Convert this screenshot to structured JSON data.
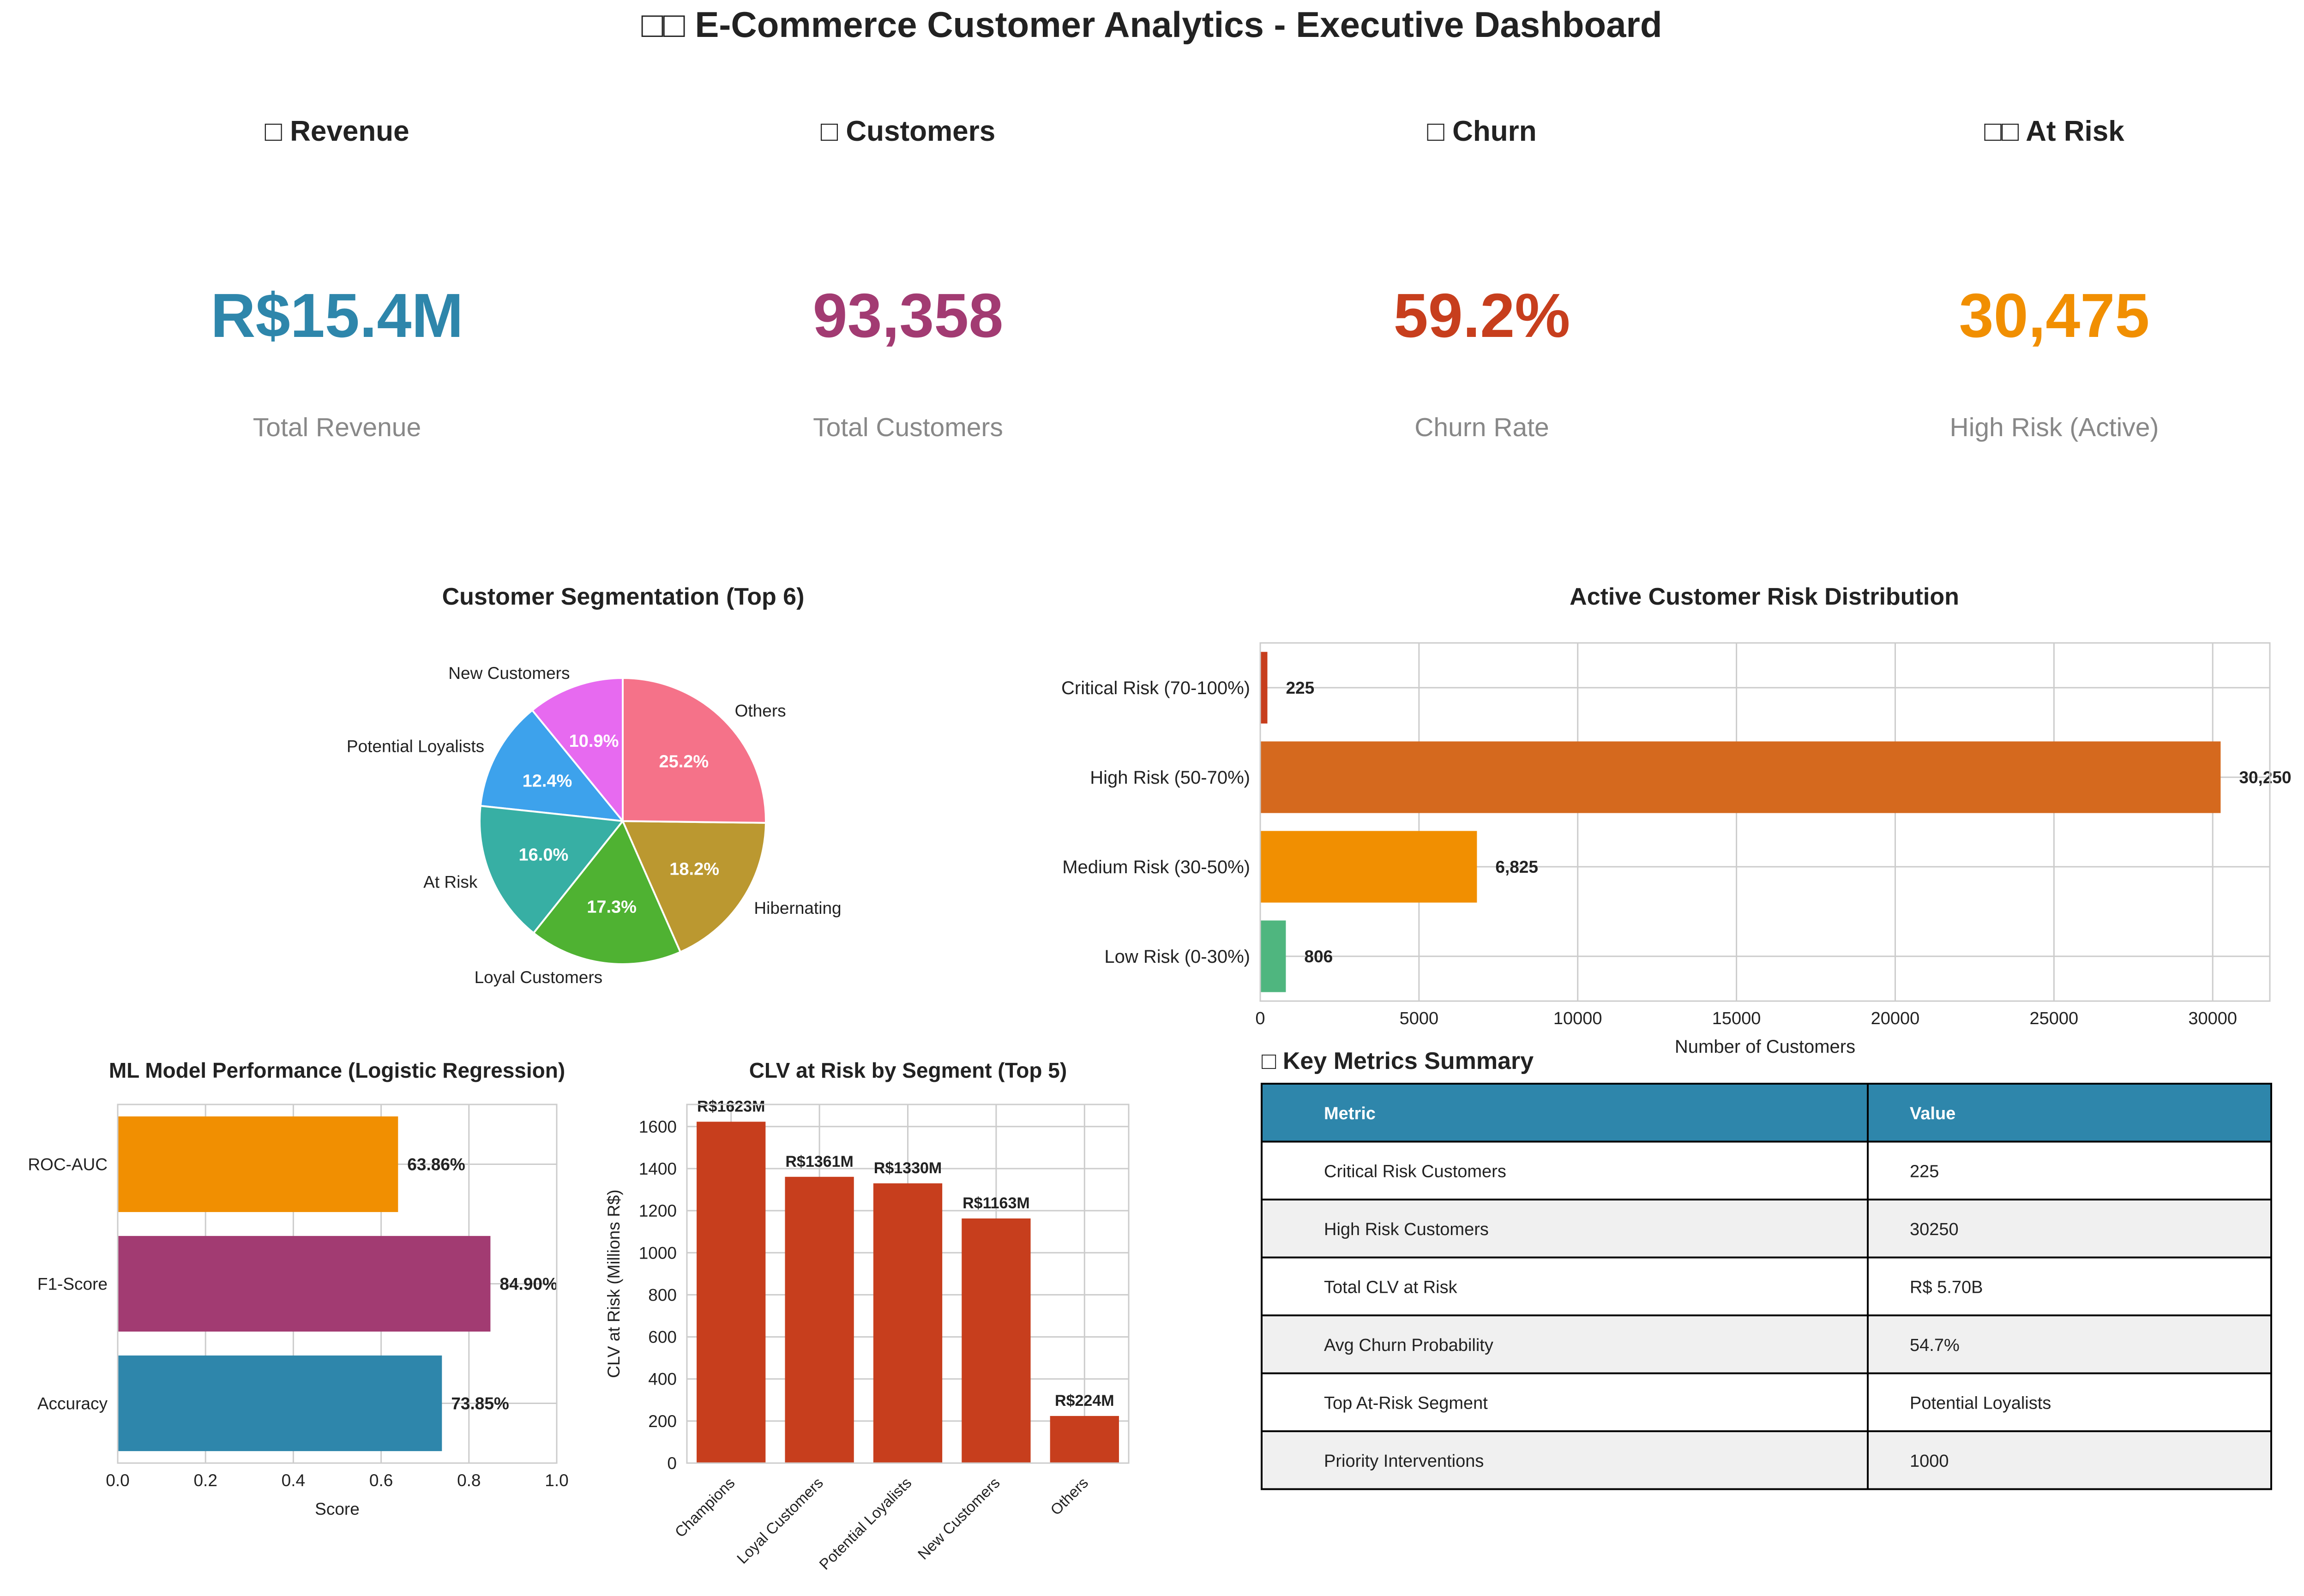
{
  "dashboard_title": "□□ E-Commerce Customer Analytics - Executive Dashboard",
  "kpis": [
    {
      "label": "□ Revenue",
      "value": "R$15.4M",
      "caption": "Total Revenue",
      "color": "#2E86AB"
    },
    {
      "label": "□ Customers",
      "value": "93,358",
      "caption": "Total Customers",
      "color": "#A23B72"
    },
    {
      "label": "□ Churn",
      "value": "59.2%",
      "caption": "Churn Rate",
      "color": "#C73E1D"
    },
    {
      "label": "□□ At Risk",
      "value": "30,475",
      "caption": "High Risk (Active)",
      "color": "#F18F01"
    }
  ],
  "chart_data": [
    {
      "id": "segmentation",
      "type": "pie",
      "title": "Customer Segmentation (Top 6)",
      "categories": [
        "New Customers",
        "Potential Loyalists",
        "At Risk",
        "Loyal Customers",
        "Hibernating",
        "Others"
      ],
      "values": [
        10.9,
        12.4,
        16.0,
        17.3,
        18.2,
        25.2
      ],
      "labels": [
        "10.9%",
        "12.4%",
        "16.0%",
        "17.3%",
        "18.2%",
        "25.2%"
      ],
      "colors": [
        "#E76AF0",
        "#3DA2EC",
        "#37AFA4",
        "#4FB232",
        "#BB9830",
        "#F57289"
      ]
    },
    {
      "id": "risk",
      "type": "bar",
      "orientation": "horizontal",
      "title": "Active Customer Risk Distribution",
      "categories": [
        "Critical Risk (70-100%)",
        "High Risk (50-70%)",
        "Medium Risk (30-50%)",
        "Low Risk (0-30%)"
      ],
      "values": [
        225,
        30250,
        6825,
        806
      ],
      "labels": [
        "225",
        "30,250",
        "6,825",
        "806"
      ],
      "colors": [
        "#C73E1D",
        "#D5691E",
        "#F18F01",
        "#4FB67F"
      ],
      "xlabel": "Number of Customers",
      "xlim": [
        0,
        31800
      ],
      "xticks": [
        0,
        5000,
        10000,
        15000,
        20000,
        25000,
        30000
      ],
      "grid": true
    },
    {
      "id": "model",
      "type": "bar",
      "orientation": "horizontal",
      "title": "ML Model Performance (Logistic Regression)",
      "categories": [
        "ROC-AUC",
        "F1-Score",
        "Accuracy"
      ],
      "values": [
        0.6386,
        0.849,
        0.7385
      ],
      "labels": [
        "63.86%",
        "84.90%",
        "73.85%"
      ],
      "colors": [
        "#F18F01",
        "#A23B72",
        "#2E86AB"
      ],
      "xlabel": "Score",
      "xlim": [
        0,
        1.0
      ],
      "xticks": [
        "0.0",
        "0.2",
        "0.4",
        "0.6",
        "0.8",
        "1.0"
      ],
      "grid": true
    },
    {
      "id": "clv",
      "type": "bar",
      "title": "CLV at Risk by Segment (Top 5)",
      "categories": [
        "Champions",
        "Loyal Customers",
        "Potential Loyalists",
        "New Customers",
        "Others"
      ],
      "values": [
        1623,
        1361,
        1330,
        1163,
        224
      ],
      "labels": [
        "R$1623M",
        "R$1361M",
        "R$1330M",
        "R$1163M",
        "R$224M"
      ],
      "color": "#C73E1D",
      "ylabel": "CLV at Risk (Millions R$)",
      "ylim": [
        0,
        1705
      ],
      "yticks": [
        0,
        200,
        400,
        600,
        800,
        1000,
        1200,
        1400,
        1600
      ],
      "grid": true
    }
  ],
  "summary": {
    "title": "□ Key Metrics Summary",
    "header": [
      "Metric",
      "Value"
    ],
    "rows": [
      [
        "Critical Risk Customers",
        "225"
      ],
      [
        "High Risk Customers",
        "30250"
      ],
      [
        "Total CLV at Risk",
        "R$ 5.70B"
      ],
      [
        "Avg Churn Probability",
        "54.7%"
      ],
      [
        "Top At-Risk Segment",
        "Potential Loyalists"
      ],
      [
        "Priority Interventions",
        "1000"
      ]
    ],
    "header_color": "#2E86AB"
  }
}
